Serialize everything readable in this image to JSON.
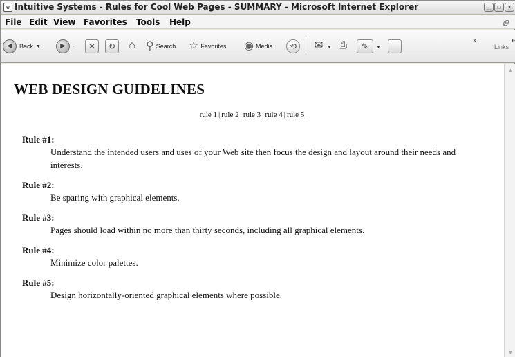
{
  "window": {
    "title": "Intuitive Systems - Rules for Cool Web Pages - SUMMARY - Microsoft Internet Explorer",
    "title_icon": "ie-page-icon"
  },
  "menu": {
    "items": [
      "File",
      "Edit",
      "View",
      "Favorites",
      "Tools",
      "Help"
    ]
  },
  "toolbar": {
    "back_label": "Back",
    "search_label": "Search",
    "favorites_label": "Favorites",
    "media_label": "Media",
    "links_label": "Links",
    "icons": [
      "back-icon",
      "forward-icon",
      "stop-icon",
      "refresh-icon",
      "home-icon",
      "search-icon",
      "favorites-star-icon",
      "media-icon",
      "history-icon",
      "mail-icon",
      "print-icon",
      "edit-icon",
      "discuss-icon"
    ]
  },
  "page": {
    "title": "WEB DESIGN GUIDELINES",
    "nav_links": [
      "rule 1",
      "rule 2",
      "rule 3",
      "rule 4",
      "rule 5"
    ],
    "nav_separator": "|",
    "rules": [
      {
        "heading": "Rule #1:",
        "text": "Understand the intended users and uses of your Web site then focus the design and layout around their needs and interests."
      },
      {
        "heading": "Rule #2:",
        "text": "Be sparing with graphical elements."
      },
      {
        "heading": "Rule #3:",
        "text": "Pages should load within no more than thirty seconds, including all graphical elements."
      },
      {
        "heading": "Rule #4:",
        "text": "Minimize color palettes."
      },
      {
        "heading": "Rule #5:",
        "text": "Design horizontally-oriented graphical elements where possible."
      }
    ]
  }
}
